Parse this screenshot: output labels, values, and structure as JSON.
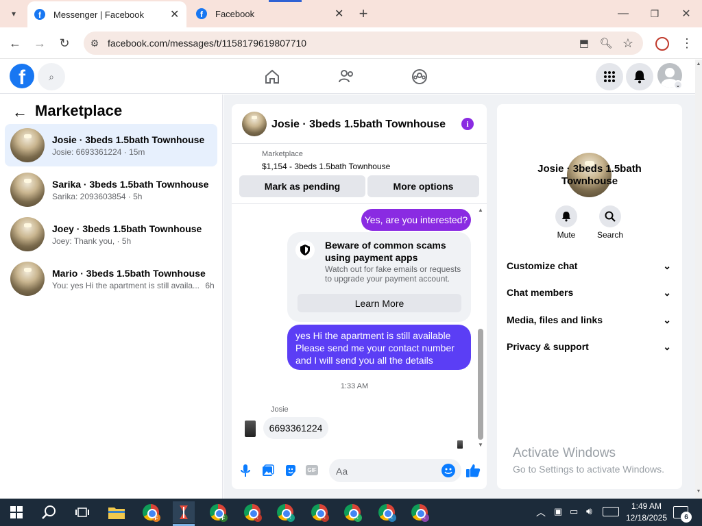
{
  "browser": {
    "tabs": [
      {
        "title": "Messenger | Facebook",
        "active": true
      },
      {
        "title": "Facebook",
        "active": false
      }
    ],
    "url": "facebook.com/messages/t/1158179619807710"
  },
  "left_panel": {
    "title": "Marketplace",
    "conversations": [
      {
        "name": "Josie · 3beds 1.5bath Townhouse",
        "preview": "Josie: 6693361224 · 15m",
        "selected": true
      },
      {
        "name": "Sarika · 3beds 1.5bath Townhouse",
        "preview": "Sarika: 2093603854 · 5h"
      },
      {
        "name": "Joey · 3beds 1.5bath Townhouse",
        "preview": "Joey: Thank you, · 5h"
      },
      {
        "name": "Mario · 3beds 1.5bath Townhouse",
        "preview": "You: yes Hi the apartment is still availa...",
        "time": "6h"
      }
    ]
  },
  "chat": {
    "header_title": "Josie · 3beds 1.5bath Townhouse",
    "listing": {
      "source": "Marketplace",
      "price_title": "$1,154 - 3beds 1.5bath Townhouse"
    },
    "mark_pending_label": "Mark as pending",
    "more_options_label": "More options",
    "msg_out_1": "Yes, are you interested?",
    "scam_title": "Beware of common scams using payment apps",
    "scam_body": "Watch out for fake emails or requests to upgrade your payment account.",
    "learn_more_label": "Learn More",
    "msg_out_2": "yes Hi the apartment is still available Please send me your contact number and I will send you all the details",
    "timestamp": "1:33 AM",
    "sender_name": "Josie",
    "msg_in_1": "6693361224",
    "composer_placeholder": "Aa"
  },
  "details": {
    "name": "Josie · 3beds 1.5bath Townhouse",
    "mute_label": "Mute",
    "search_label": "Search",
    "sections": [
      "Customize chat",
      "Chat members",
      "Media, files and links",
      "Privacy & support"
    ]
  },
  "watermark": {
    "line1": "Activate Windows",
    "line2": "Go to Settings to activate Windows."
  },
  "taskbar": {
    "time": "1:49 AM",
    "date": "12/18/2025",
    "notification_count": "6"
  },
  "colors": {
    "fb_blue": "#1877f2",
    "messenger_purple": "#8a2be2",
    "bubble_blue": "#5b3ef5",
    "taskbar": "#1c2b3a"
  }
}
